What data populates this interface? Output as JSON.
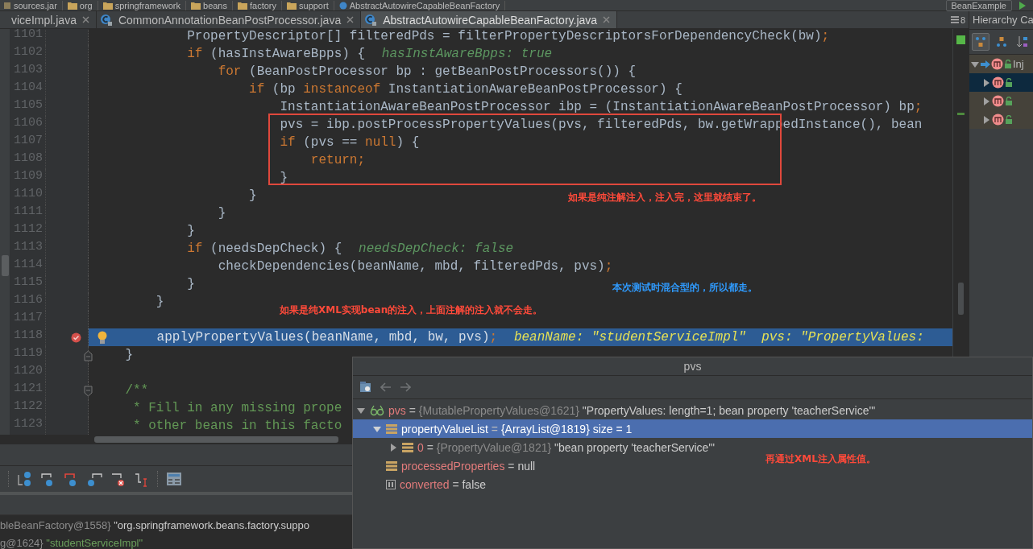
{
  "breadcrumb": [
    {
      "label": "sources.jar",
      "kind": "jar"
    },
    {
      "label": "org",
      "kind": "folder"
    },
    {
      "label": "springframework",
      "kind": "folder"
    },
    {
      "label": "beans",
      "kind": "folder"
    },
    {
      "label": "factory",
      "kind": "folder"
    },
    {
      "label": "support",
      "kind": "folder"
    },
    {
      "label": "AbstractAutowireCapableBeanFactory",
      "kind": "class"
    }
  ],
  "run_config": "BeanExample",
  "tabs": [
    {
      "label": "viceImpl.java",
      "kind": "plain",
      "selected": false
    },
    {
      "label": "CommonAnnotationBeanPostProcessor.java",
      "kind": "class",
      "selected": false
    },
    {
      "label": "AbstractAutowireCapableBeanFactory.java",
      "kind": "class",
      "selected": true
    }
  ],
  "hidden_tabs_count": "8",
  "editor": {
    "lines": [
      {
        "number": "1101",
        "current": false,
        "breakpoint": false,
        "code": [
          {
            "kind": "plain",
            "text": "            PropertyDescriptor[] filteredPds = filterPropertyDescriptorsForDependencyCheck(bw)"
          },
          {
            "kind": "keyword",
            "text": ";"
          }
        ]
      },
      {
        "number": "1102",
        "current": false,
        "breakpoint": false,
        "code": [
          {
            "kind": "keyword",
            "text": "            if"
          },
          {
            "kind": "plain",
            "text": " (hasInstAwareBpps) {"
          }
        ],
        "hint": "hasInstAwareBpps: true"
      },
      {
        "number": "1103",
        "current": false,
        "breakpoint": false,
        "code": [
          {
            "kind": "keyword",
            "text": "                for"
          },
          {
            "kind": "plain",
            "text": " (BeanPostProcessor bp : getBeanPostProcessors()) {"
          }
        ]
      },
      {
        "number": "1104",
        "current": false,
        "breakpoint": false,
        "code": [
          {
            "kind": "keyword",
            "text": "                    if"
          },
          {
            "kind": "plain",
            "text": " (bp "
          },
          {
            "kind": "keyword",
            "text": "instanceof"
          },
          {
            "kind": "plain",
            "text": " InstantiationAwareBeanPostProcessor) {"
          }
        ]
      },
      {
        "number": "1105",
        "current": false,
        "breakpoint": false,
        "code": [
          {
            "kind": "plain",
            "text": "                        InstantiationAwareBeanPostProcessor ibp = (InstantiationAwareBeanPostProcessor) bp"
          },
          {
            "kind": "keyword",
            "text": ";"
          }
        ]
      },
      {
        "number": "1106",
        "current": false,
        "breakpoint": false,
        "code": [
          {
            "kind": "plain",
            "text": "                        pvs = ibp.postProcessPropertyValues(pvs, filteredPds, bw.getWrappedInstance(), bean"
          }
        ]
      },
      {
        "number": "1107",
        "current": false,
        "breakpoint": false,
        "code": [
          {
            "kind": "keyword",
            "text": "                        if"
          },
          {
            "kind": "plain",
            "text": " (pvs == "
          },
          {
            "kind": "keyword",
            "text": "null"
          },
          {
            "kind": "plain",
            "text": ") {"
          }
        ]
      },
      {
        "number": "1108",
        "current": false,
        "breakpoint": false,
        "code": [
          {
            "kind": "keyword",
            "text": "                            return;"
          }
        ]
      },
      {
        "number": "1109",
        "current": false,
        "breakpoint": false,
        "code": [
          {
            "kind": "plain",
            "text": "                        }"
          }
        ]
      },
      {
        "number": "1110",
        "current": false,
        "breakpoint": false,
        "code": [
          {
            "kind": "plain",
            "text": "                    }"
          }
        ]
      },
      {
        "number": "1111",
        "current": false,
        "breakpoint": false,
        "code": [
          {
            "kind": "plain",
            "text": "                }"
          }
        ]
      },
      {
        "number": "1112",
        "current": false,
        "breakpoint": false,
        "code": [
          {
            "kind": "plain",
            "text": "            }"
          }
        ]
      },
      {
        "number": "1113",
        "current": false,
        "breakpoint": false,
        "code": [
          {
            "kind": "keyword",
            "text": "            if"
          },
          {
            "kind": "plain",
            "text": " (needsDepCheck) {"
          }
        ],
        "hint": "needsDepCheck: false"
      },
      {
        "number": "1114",
        "current": false,
        "breakpoint": false,
        "code": [
          {
            "kind": "plain",
            "text": "                checkDependencies(beanName, mbd, filteredPds, pvs)"
          },
          {
            "kind": "keyword",
            "text": ";"
          }
        ]
      },
      {
        "number": "1115",
        "current": false,
        "breakpoint": false,
        "code": [
          {
            "kind": "plain",
            "text": "            }"
          }
        ]
      },
      {
        "number": "1116",
        "current": false,
        "breakpoint": false,
        "code": [
          {
            "kind": "plain",
            "text": "        }"
          }
        ]
      },
      {
        "number": "1117",
        "current": false,
        "breakpoint": false
      },
      {
        "number": "1118",
        "current": true,
        "breakpoint": true,
        "code": [
          {
            "kind": "plain",
            "text": "      applyPropertyValues(beanName, mbd, bw, pvs)"
          },
          {
            "kind": "keyword",
            "text": ";"
          }
        ],
        "hint": "beanName: \"studentServiceImpl\"  pvs: \"PropertyValues:"
      },
      {
        "number": "1119",
        "current": false,
        "breakpoint": false,
        "fold_end": true,
        "code": [
          {
            "kind": "plain",
            "text": "    }"
          }
        ]
      },
      {
        "number": "1120",
        "current": false,
        "breakpoint": false
      },
      {
        "number": "1121",
        "current": false,
        "breakpoint": false,
        "fold_start": true,
        "code": [
          {
            "kind": "comment",
            "text": "    /**"
          }
        ]
      },
      {
        "number": "1122",
        "current": false,
        "breakpoint": false,
        "code": [
          {
            "kind": "comment",
            "text": "     * Fill in any missing prope"
          }
        ]
      },
      {
        "number": "1123",
        "current": false,
        "breakpoint": false,
        "code": [
          {
            "kind": "comment",
            "text": "     * other beans in this facto"
          }
        ]
      }
    ]
  },
  "annotations": [
    {
      "text": "如果是纯注解注入，注入完，这里就结束了。",
      "color": "#ff4a3a"
    },
    {
      "text": "本次测试时混合型的，所以都走。",
      "color": "#2f9bff"
    },
    {
      "text": "如果是纯XML实现bean的注入，上面注解的注入就不会走。",
      "color": "#ff4a3a"
    },
    {
      "text": "再通过XML注入属性值。",
      "color": "#ff4a3a"
    }
  ],
  "hierarchy": {
    "title": "Hierarchy Ca",
    "items": [
      {
        "label": "Inj",
        "expanded": true,
        "selected": false,
        "children": [
          {
            "expanded": false,
            "selected": true
          },
          {
            "expanded": false,
            "selected": false
          },
          {
            "expanded": false,
            "selected": false
          }
        ]
      }
    ]
  },
  "frame_variables": [
    {
      "type": "bleBeanFactory@1558}",
      "value": "\"org.springframework.beans.factory.suppo",
      "kind": "object"
    },
    {
      "type": "g@1624}",
      "value": "\"studentServiceImpl\"",
      "kind": "string"
    }
  ],
  "popup": {
    "title": "pvs",
    "tree": [
      {
        "name": "pvs",
        "op": "=",
        "type": "{MutablePropertyValues@1621}",
        "value": "\"PropertyValues: length=1; bean property 'teacherService'\"",
        "kind": "watch",
        "expanded": true,
        "selected": false,
        "children": [
          {
            "name": "propertyValueList",
            "op": "=",
            "type": "{ArrayList@1819}",
            "value": "size = 1",
            "kind": "field",
            "expanded": true,
            "selected": true,
            "children": [
              {
                "name": "0",
                "op": "=",
                "type": "{PropertyValue@1821}",
                "value": "\"bean property 'teacherService'\"",
                "kind": "field",
                "expanded": false,
                "selected": false
              }
            ]
          },
          {
            "name": "processedProperties",
            "op": "=",
            "value": "null",
            "kind": "field",
            "selected": false
          },
          {
            "name": "converted",
            "op": "=",
            "value": "false",
            "kind": "boolean",
            "selected": false
          }
        ]
      }
    ]
  }
}
